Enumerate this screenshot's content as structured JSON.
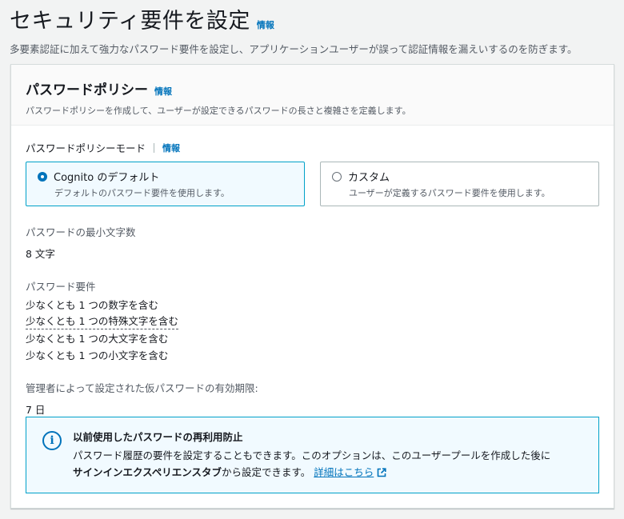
{
  "page": {
    "title": "セキュリティ要件を設定",
    "info": "情報",
    "description": "多要素認証に加えて強力なパスワード要件を設定し、アプリケーションユーザーが誤って認証情報を漏えいするのを防ぎます。"
  },
  "policy": {
    "title": "パスワードポリシー",
    "info": "情報",
    "description": "パスワードポリシーを作成して、ユーザーが設定できるパスワードの長さと複雑さを定義します。",
    "mode_label": "パスワードポリシーモード",
    "mode_info": "情報",
    "options": [
      {
        "label": "Cognito のデフォルト",
        "description": "デフォルトのパスワード要件を使用します。",
        "selected": true
      },
      {
        "label": "カスタム",
        "description": "ユーザーが定義するパスワード要件を使用します。",
        "selected": false
      }
    ],
    "min_length_label": "パスワードの最小文字数",
    "min_length_value": "8 文字",
    "requirements_label": "パスワード要件",
    "requirements": [
      "少なくとも 1 つの数字を含む",
      "少なくとも 1 つの特殊文字を含む",
      "少なくとも 1 つの大文字を含む",
      "少なくとも 1 つの小文字を含む"
    ],
    "temp_expiry_label": "管理者によって設定された仮パスワードの有効期限:",
    "temp_expiry_value": "7 日"
  },
  "alert": {
    "icon": "info-circle-icon",
    "title": "以前使用したパスワードの再利用防止",
    "line1": "パスワード履歴の要件を設定することもできます。このオプションは、このユーザープールを作成した後に",
    "bold": "サインインエクスペリエンスタブ",
    "line2_rest": "から設定できます。",
    "link": "詳細はこちら"
  },
  "colors": {
    "accent": "#0073bb",
    "selected_border": "#00a1c9",
    "selected_bg": "#f1faff"
  }
}
